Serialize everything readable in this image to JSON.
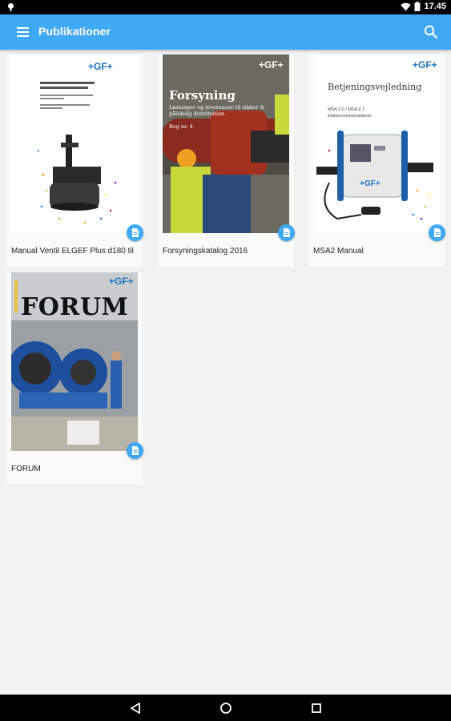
{
  "status_bar": {
    "time": "17.45"
  },
  "app_bar": {
    "title": "Publikationer"
  },
  "publications": [
    {
      "label": "Manual Ventil ELGEF Plus d180 til",
      "cover_logo": "+GF+"
    },
    {
      "label": "Forsyningskatalog 2016",
      "cover_logo": "+GF+",
      "cover_title": "Forsyning",
      "cover_subtitle": "Løsninger og leverancer til sikker & pålidelig distribution",
      "cover_extra": "Bog nr. 4"
    },
    {
      "label": "MSA2 Manual",
      "cover_logo": "+GF+",
      "cover_title": "Betjeningsvejledning",
      "cover_subtitle": "MSA 2.0 / MSA 2.1",
      "cover_extra": "Elektrosvejsemaskiner",
      "device_logo": "+GF+"
    },
    {
      "label": "FORUM",
      "cover_logo": "+GF+",
      "cover_title": "FORUM"
    }
  ],
  "colors": {
    "accent": "#3fa9f5",
    "brand_blue": "#1e73be"
  }
}
